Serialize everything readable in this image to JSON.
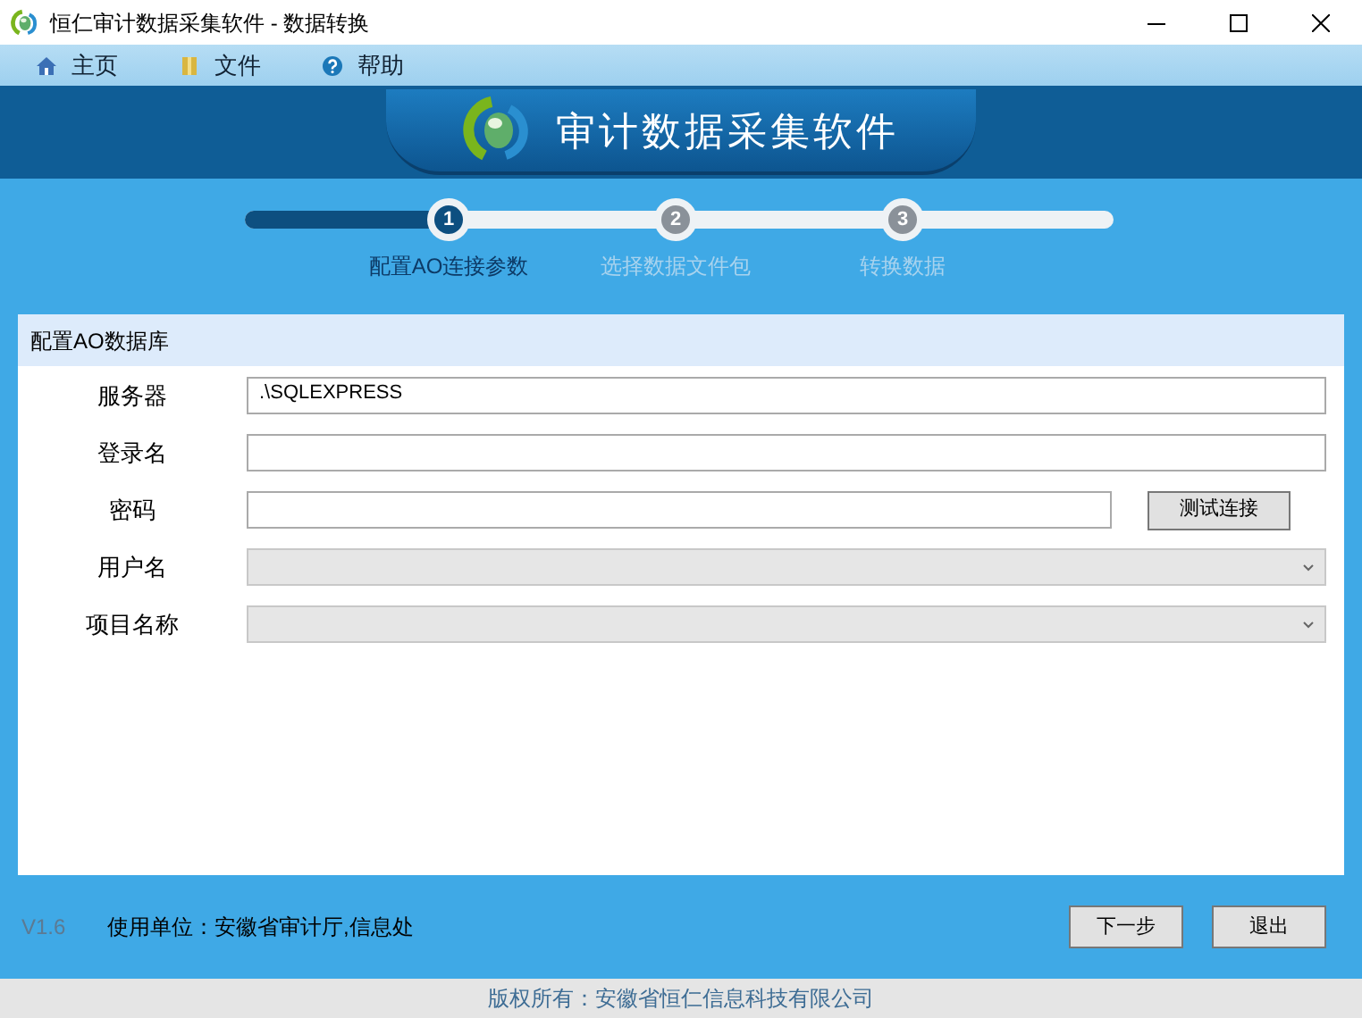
{
  "window": {
    "title": "恒仁审计数据采集软件 - 数据转换"
  },
  "menu": [
    {
      "label": "主页",
      "kind": "home"
    },
    {
      "label": "文件",
      "kind": "file"
    },
    {
      "label": "帮助",
      "kind": "help"
    }
  ],
  "banner": {
    "title": "审计数据采集软件"
  },
  "progress": {
    "level": 0.24
  },
  "steps": [
    {
      "number": "1",
      "label": "配置AO连接参数",
      "selected": true
    },
    {
      "number": "2",
      "label": "选择数据文件包",
      "selected": false
    },
    {
      "number": "3",
      "label": "转换数据",
      "selected": false
    }
  ],
  "panel": {
    "title": "配置AO数据库"
  },
  "fields": [
    {
      "label": "服务器",
      "kind": "text",
      "value": ".\\SQLEXPRESS",
      "disabled": false
    },
    {
      "label": "登录名",
      "kind": "text",
      "disabled": false
    },
    {
      "label": "密码",
      "kind": "text",
      "disabled": false,
      "button": "测试连接"
    },
    {
      "label": "用户名",
      "kind": "combo",
      "disabled": true
    },
    {
      "label": "项目名称",
      "kind": "combo",
      "disabled": true
    }
  ],
  "version": "V1.6",
  "user_unit": "使用单位：安徽省审计厅,信息处",
  "buttons": [
    "下一步",
    "退出"
  ],
  "copyright": "版权所有：安徽省恒仁信息科技有限公司"
}
